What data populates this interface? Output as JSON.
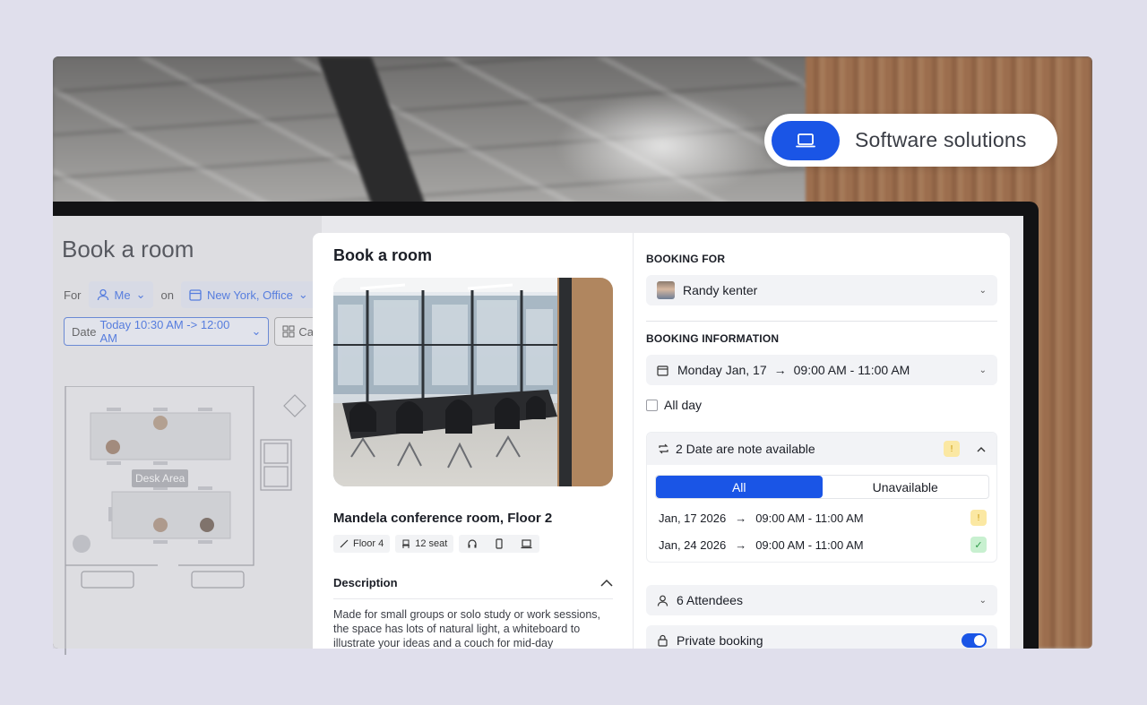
{
  "badge": {
    "label": "Software solutions",
    "icon": "laptop-icon"
  },
  "background_app": {
    "title": "Book a room",
    "for_label": "For",
    "me_label": "Me",
    "on_label": "on",
    "location_label": "New York, Office",
    "date_prefix": "Date",
    "date_value": "Today 10:30 AM -> 12:00 AM",
    "category_label": "Ca",
    "desk_area_label": "Desk Area"
  },
  "modal": {
    "title": "Book a room",
    "room_name": "Mandela conference room, Floor 2",
    "tags": {
      "floor": "Floor 4",
      "seats": "12 seat"
    },
    "description_heading": "Description",
    "description_text": "Made for small groups or solo study or work sessions, the space has lots of natural light, a whiteboard to illustrate your ideas and a couch for mid-day"
  },
  "booking": {
    "booking_for_label": "BOOKING FOR",
    "booking_for_value": "Randy kenter",
    "booking_info_label": "BOOKING INFORMATION",
    "date_value": "Monday Jan, 17",
    "time_value": "09:00 AM - 11:00 AM",
    "all_day_label": "All day",
    "availability_title": "2 Date are note available",
    "segment_all": "All",
    "segment_unavailable": "Unavailable",
    "dates": [
      {
        "date": "Jan, 17 2026",
        "time": "09:00 AM - 11:00 AM",
        "status": "warning"
      },
      {
        "date": "Jan, 24 2026",
        "time": "09:00 AM - 11:00 AM",
        "status": "available"
      }
    ],
    "attendees_label": "6 Attendees",
    "private_booking_label": "Private booking",
    "private_booking_on": true
  },
  "colors": {
    "accent": "#1a55e6",
    "warning": "#fbe8a3",
    "success": "#c8f0d0"
  }
}
